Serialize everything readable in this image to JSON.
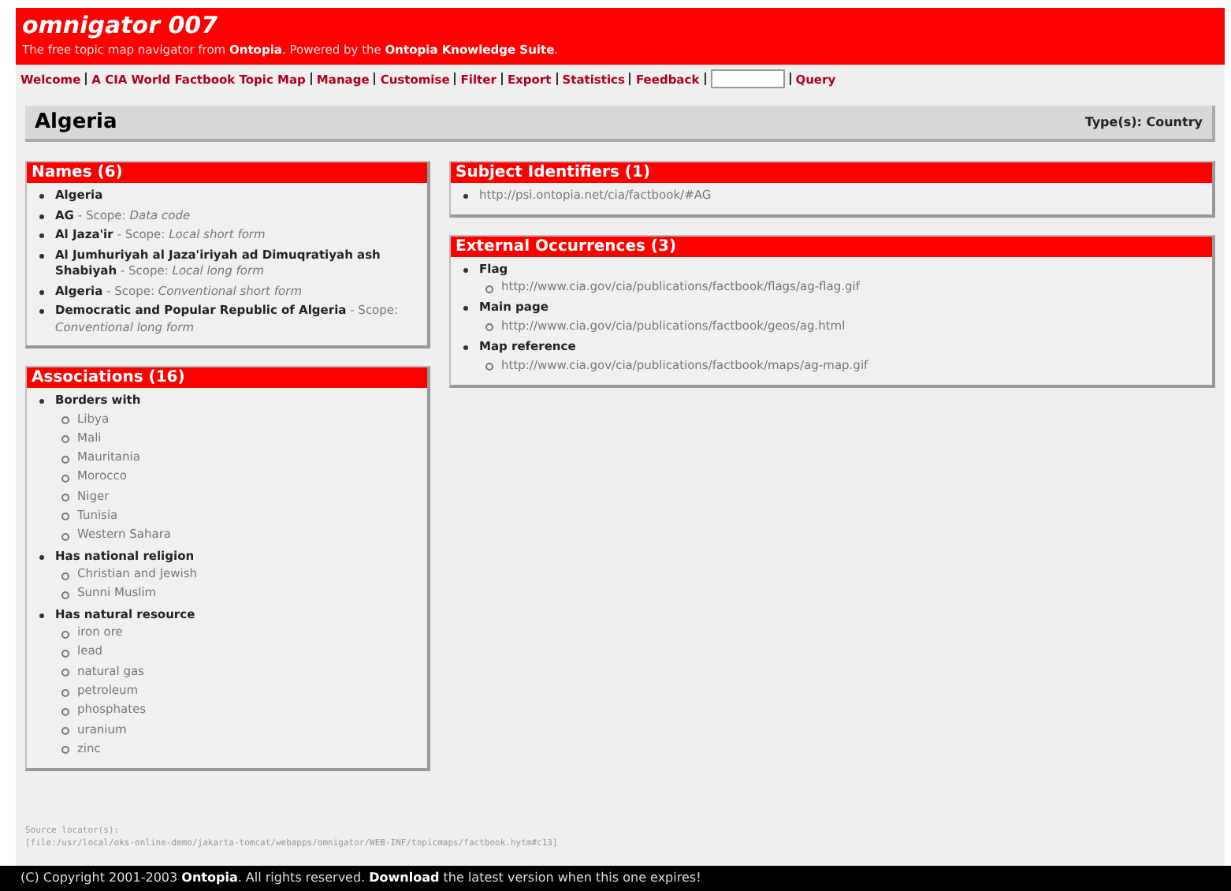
{
  "header": {
    "title": "omnigator 007",
    "tagline": "The free topic map navigator from **Ontopia**. Powered by the **Ontopia Knowledge Suite**."
  },
  "nav": [
    {
      "kind": "link",
      "label": "Welcome"
    },
    {
      "kind": "link",
      "label": "A CIA World Factbook Topic Map"
    },
    {
      "kind": "link",
      "label": "Manage"
    },
    {
      "kind": "link",
      "label": "Customise"
    },
    {
      "kind": "link",
      "label": "Filter"
    },
    {
      "kind": "link",
      "label": "Export"
    },
    {
      "kind": "link",
      "label": "Statistics"
    },
    {
      "kind": "link",
      "label": "Feedback"
    },
    {
      "kind": "field"
    },
    {
      "kind": "link",
      "label": "Query"
    }
  ],
  "topic": {
    "name": "Algeria",
    "types": "Type(s): Country"
  },
  "names": {
    "title": "Names (6)",
    "items": [
      "**Algeria**",
      "**AG** - Scope: *Data code*",
      "**Al Jaza'ir** - Scope: *Local short form*",
      "**Al Jumhuriyah al Jaza'iriyah ad Dimuqratiyah ash Shabiyah** - Scope: *Local long form*",
      "**Algeria** - Scope: *Conventional short form*",
      "**Democratic and Popular Republic of Algeria** - Scope: *Conventional long form*"
    ]
  },
  "associations": {
    "title": "Associations (16)",
    "groups": [
      {
        "label": "Borders with",
        "items": [
          "Libya",
          "Mali",
          "Mauritania",
          "Morocco",
          "Niger",
          "Tunisia",
          "Western Sahara"
        ]
      },
      {
        "label": "Has national religion",
        "items": [
          "Christian and Jewish",
          "Sunni Muslim"
        ]
      },
      {
        "label": "Has natural resource",
        "items": [
          "iron ore",
          "lead",
          "natural gas",
          "petroleum",
          "phosphates",
          "uranium",
          "zinc"
        ]
      }
    ]
  },
  "subject_identifiers": {
    "title": "Subject Identifiers (1)",
    "items": [
      "http://psi.ontopia.net/cia/factbook/#AG"
    ]
  },
  "occurrences": {
    "title": "External Occurrences (3)",
    "groups": [
      {
        "label": "Flag",
        "items": [
          "http://www.cia.gov/cia/publications/factbook/flags/ag-flag.gif"
        ]
      },
      {
        "label": "Main page",
        "items": [
          "http://www.cia.gov/cia/publications/factbook/geos/ag.html"
        ]
      },
      {
        "label": "Map reference",
        "items": [
          "http://www.cia.gov/cia/publications/factbook/maps/ag-map.gif"
        ]
      }
    ]
  },
  "source_locator": {
    "label": "Source locator(s):",
    "value": "[file:/usr/local/oks-online-demo/jakarta-tomcat/webapps/omnigator/WEB-INF/topicmaps/factbook.hytm#c13]"
  },
  "footer": "(C) Copyright 2001-2003 **Ontopia**. All rights reserved. **Download** the latest version when this one expires!"
}
